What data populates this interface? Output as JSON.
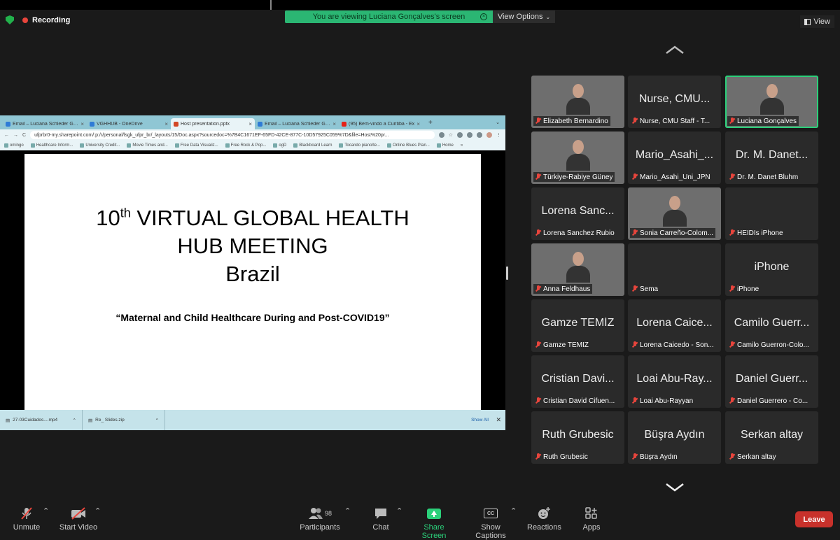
{
  "status": {
    "recording": "Recording",
    "viewing": "You are viewing Luciana Gonçalves's screen",
    "view_options": "View Options",
    "view": "View"
  },
  "browser": {
    "tabs": [
      {
        "label": "Email – Luciana Schleder Gonçalves",
        "color": "#2e7bd6"
      },
      {
        "label": "VGHHUB - OneDrive",
        "color": "#2e7bd6"
      },
      {
        "label": "Host presentation.pptx",
        "color": "#d24726"
      },
      {
        "label": "Email – Luciana Schleder Gonçalves",
        "color": "#2e7bd6"
      },
      {
        "label": "(95) Bem-vindo a Curitiba - Ex",
        "color": "#e62117"
      }
    ],
    "url": "ufprbr0-my.sharepoint.com/:p:/r/personal/lsgk_ufpr_br/_layouts/15/Doc.aspx?sourcedoc=%7B4C1671EF-65FD-42CE-877C-10D57925C059%7D&file=Host%20pr...",
    "bookmarks": [
      "omingo",
      "Healthcare Inform...",
      "University Credit...",
      "Movie Times and...",
      "Free Data Visualiz...",
      "Free Rock & Pop...",
      "ogD",
      "Blackboard Learn",
      "Tocando piano/te...",
      "Online Blues Plan...",
      "Home"
    ],
    "downloads": [
      "27-03Cuidados....mp4",
      "Re_ Slides.zip"
    ],
    "show_all": "Show All"
  },
  "slide": {
    "title_num": "10",
    "title_sup": "th",
    "title_rest": " VIRTUAL GLOBAL HEALTH",
    "line2": "HUB MEETING",
    "line3": "Brazil",
    "subtitle": "“Maternal and Child Healthcare During and Post-COVID19”"
  },
  "participants": [
    {
      "big": "",
      "name": "Elizabeth Bernardino",
      "video": true
    },
    {
      "big": "Nurse, CMU...",
      "name": "Nurse, CMU Staff - T...",
      "video": false
    },
    {
      "big": "",
      "name": "Luciana Gonçalves",
      "video": true,
      "active": true
    },
    {
      "big": "",
      "name": "Türkiye-Rabiye Güney",
      "video": true
    },
    {
      "big": "Mario_Asahi_...",
      "name": "Mario_Asahi_Uni_JPN",
      "video": false
    },
    {
      "big": "Dr. M. Danet...",
      "name": "Dr. M. Danet Bluhm",
      "video": false
    },
    {
      "big": "Lorena Sanc...",
      "name": "Lorena Sanchez Rubio",
      "video": false
    },
    {
      "big": "",
      "name": "Sonia Carreño-Colom...",
      "video": true
    },
    {
      "big": "",
      "name": "HEIDIs iPhone",
      "video": false
    },
    {
      "big": "",
      "name": "Anna Feldhaus",
      "video": true
    },
    {
      "big": "",
      "name": "Sema",
      "video": false
    },
    {
      "big": "iPhone",
      "name": "iPhone",
      "video": false
    },
    {
      "big": "Gamze TEMİZ",
      "name": "Gamze TEMİZ",
      "video": false
    },
    {
      "big": "Lorena Caice...",
      "name": "Lorena Caicedo - Son...",
      "video": false
    },
    {
      "big": "Camilo Guerr...",
      "name": "Camilo Guerron-Colo...",
      "video": false
    },
    {
      "big": "Cristian Davi...",
      "name": "Cristian David Cifuen...",
      "video": false
    },
    {
      "big": "Loai Abu-Ray...",
      "name": "Loai Abu-Rayyan",
      "video": false
    },
    {
      "big": "Daniel Guerr...",
      "name": "Daniel Guerrero - Co...",
      "video": false
    },
    {
      "big": "Ruth Grubesic",
      "name": "Ruth Grubesic",
      "video": false
    },
    {
      "big": "Büşra Aydın",
      "name": "Büşra Aydın",
      "video": false
    },
    {
      "big": "Serkan altay",
      "name": "Serkan altay",
      "video": false
    }
  ],
  "toolbar": {
    "unmute": "Unmute",
    "start_video": "Start Video",
    "participants": "Participants",
    "participant_count": "98",
    "chat": "Chat",
    "share": "Share Screen",
    "captions": "Show Captions",
    "cc": "CC",
    "reactions": "Reactions",
    "apps": "Apps",
    "leave": "Leave"
  }
}
